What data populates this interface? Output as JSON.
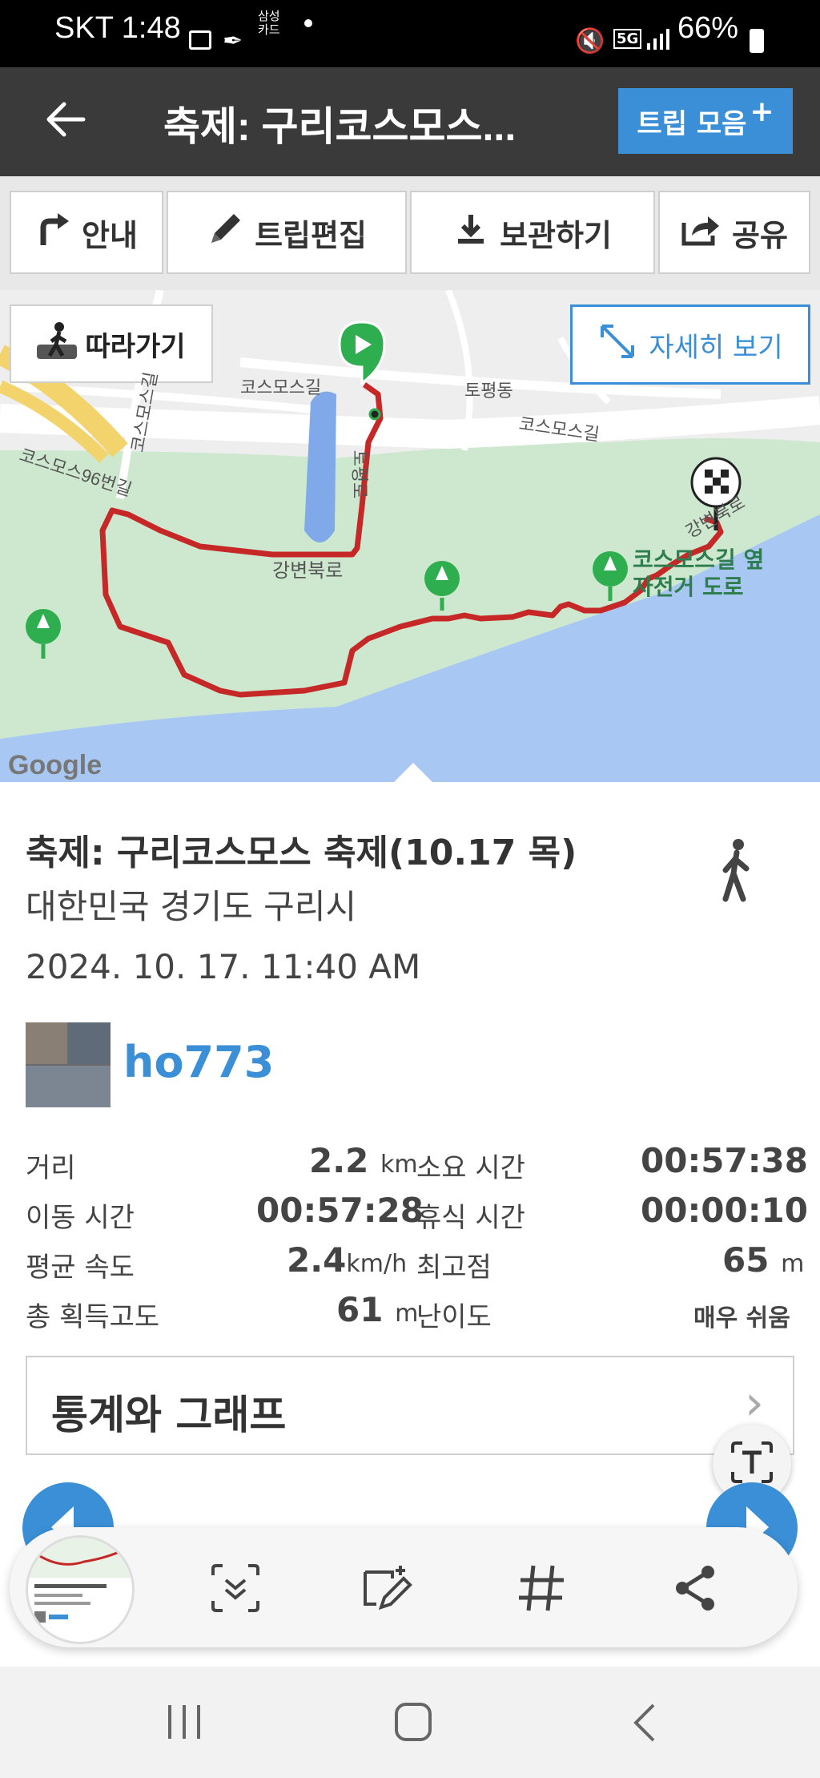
{
  "status_bar": {
    "time": "SKT 1:48",
    "card_line1": "삼성",
    "card_line2": "카드",
    "battery": "66%"
  },
  "header": {
    "title": "축제: 구리코스모스...",
    "trip_button": "트립 모음"
  },
  "toolbar": {
    "guide": "안내",
    "edit": "트립편집",
    "save": "보관하기",
    "share": "공유"
  },
  "map": {
    "follow_button": "따라가기",
    "detail_button": "자세히 보기",
    "labels": {
      "cosmos_gil_1": "코스모스길",
      "cosmos_gil_2": "코스모스길",
      "cosmos_gil_3": "코스모스길",
      "cosmos_96": "코스모스96번길",
      "topyeong": "토평동",
      "gangbyeon_1": "강변북로",
      "gangbyeon_2": "강변북로",
      "tobyeong_ro": "토평로",
      "bike_line1": "코스모스길 옆",
      "bike_line2": "자전거 도로",
      "google": "Google"
    }
  },
  "trip": {
    "title": "축제: 구리코스모스 축제(10.17 목)",
    "location": "대한민국 경기도 구리시",
    "datetime": "2024. 10. 17. 11:40 AM",
    "user": "ho773"
  },
  "stats": {
    "distance_label": "거리",
    "distance_value": "2.2",
    "distance_unit": "km",
    "duration_label": "소요 시간",
    "duration_value": "00:57:38",
    "moving_label": "이동 시간",
    "moving_value": "00:57:28",
    "rest_label": "휴식 시간",
    "rest_value": "00:00:10",
    "speed_label": "평균 속도",
    "speed_value": "2.4",
    "speed_unit": "km/h",
    "max_alt_label": "최고점",
    "max_alt_value": "65",
    "max_alt_unit": "m",
    "gain_label": "총 획득고도",
    "gain_value": "61",
    "gain_unit": "m",
    "difficulty_label": "난이도",
    "difficulty_value": "매우 쉬움"
  },
  "stats_graph_button": "통계와 그래프",
  "colors": {
    "header_bg": "#3a3a3a",
    "accent_blue": "#3b8fd6",
    "route_red": "#c62828",
    "water": "#a8c7f2",
    "park": "#cde8cf"
  }
}
